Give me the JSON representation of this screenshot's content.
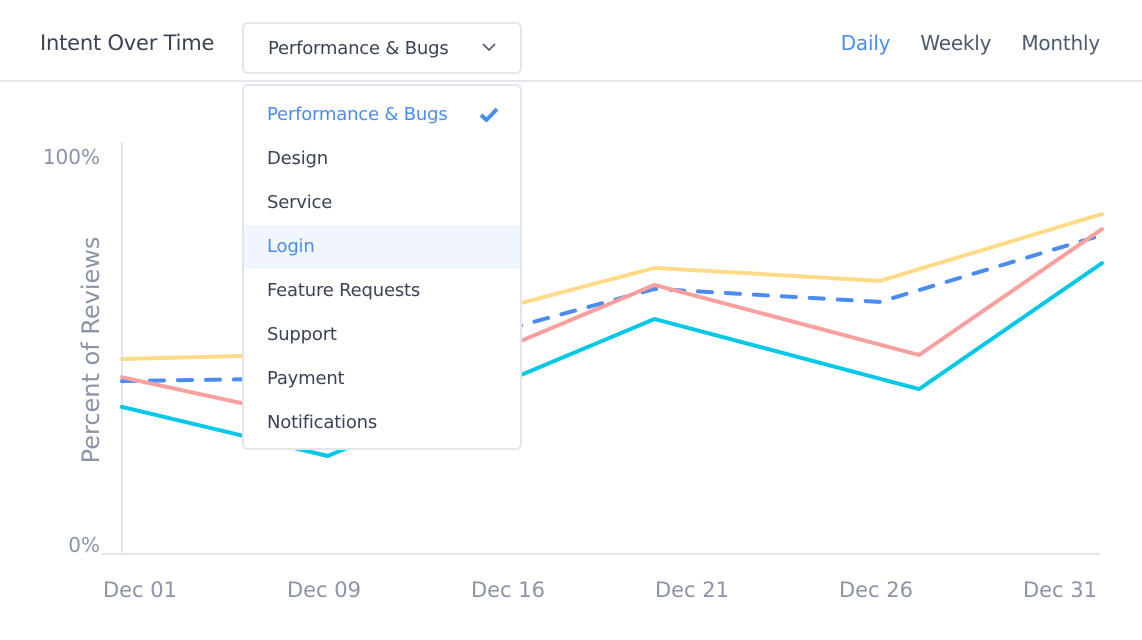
{
  "header": {
    "title": "Intent Over Time",
    "select_value": "Performance & Bugs",
    "tabs": [
      {
        "label": "Daily",
        "active": true
      },
      {
        "label": "Weekly",
        "active": false
      },
      {
        "label": "Monthly",
        "active": false
      }
    ]
  },
  "dropdown": {
    "items": [
      {
        "label": "Performance & Bugs",
        "state": "selected"
      },
      {
        "label": "Design",
        "state": ""
      },
      {
        "label": "Service",
        "state": ""
      },
      {
        "label": "Login",
        "state": "hover"
      },
      {
        "label": "Feature Requests",
        "state": ""
      },
      {
        "label": "Support",
        "state": ""
      },
      {
        "label": "Payment",
        "state": ""
      },
      {
        "label": "Notifications",
        "state": ""
      }
    ],
    "icons": {
      "chevron": "chevron-down-icon",
      "check": "checkmark-icon"
    }
  },
  "chart_data": {
    "type": "line",
    "title": "Intent Over Time",
    "xlabel": "",
    "ylabel": "Percent of Reviews",
    "ylim": [
      0,
      100
    ],
    "y_ticks": [
      "0%",
      "100%"
    ],
    "x_ticks": [
      "Dec 01",
      "Dec 09",
      "Dec 16",
      "Dec 21",
      "Dec 26",
      "Dec 31"
    ],
    "xlim": [
      1,
      31
    ],
    "grid": false,
    "legend": "none",
    "series": [
      {
        "name": "series-yellow",
        "color": "#FFDB87",
        "dashed": false,
        "x": [
          1,
          7.3,
          17.3,
          24.2,
          31
        ],
        "values": [
          49.0,
          50.3,
          72.0,
          68.7,
          85.6
        ]
      },
      {
        "name": "series-dashed-blue",
        "color": "#4A8CF0",
        "dashed": true,
        "x": [
          1,
          7.3,
          17.3,
          24.2,
          31
        ],
        "values": [
          43.4,
          44.2,
          66.7,
          63.4,
          80.3
        ]
      },
      {
        "name": "series-pink",
        "color": "#F9A09E",
        "dashed": false,
        "x": [
          1,
          7.3,
          17.3,
          25.4,
          31
        ],
        "values": [
          44.4,
          33.1,
          67.7,
          50.0,
          81.8
        ]
      },
      {
        "name": "series-cyan",
        "color": "#00C8E6",
        "dashed": false,
        "x": [
          1,
          7.3,
          17.3,
          25.4,
          31
        ],
        "values": [
          36.9,
          24.5,
          59.1,
          41.4,
          73.2
        ]
      }
    ]
  }
}
